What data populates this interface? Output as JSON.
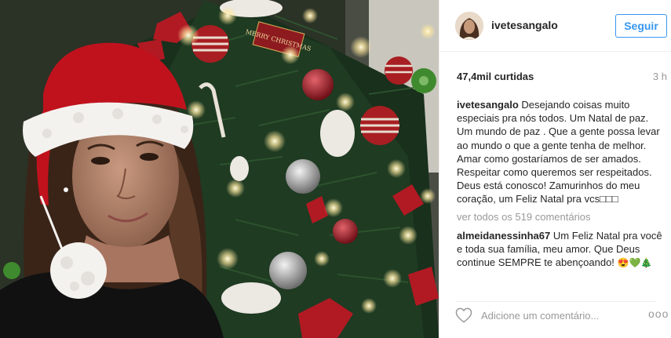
{
  "photo": {
    "alt_icon": "selfie-christmas-tree-photo",
    "ornament_text": "MERRY CHRISTMAS"
  },
  "header": {
    "username": "ivetesangalo",
    "follow_label": "Seguir",
    "accent_color": "#3897f0"
  },
  "stats": {
    "likes": "47,4mil curtidas",
    "time": "3 h"
  },
  "caption": {
    "username": "ivetesangalo",
    "text": "Desejando coisas muito especiais pra nós todos. Um Natal de paz. Um mundo de paz . Que a gente possa levar ao mundo o que a gente tenha de melhor. Amar como gostaríamos de ser amados. Respeitar como queremos ser respeitados. Deus está conosco! Zamurinhos do meu coração, um Feliz Natal pra vcs□□□"
  },
  "view_all": "ver todos os 519 comentários",
  "comment": {
    "username": "almeidanessinha67",
    "text": "Um Feliz Natal pra você e toda sua família, meu amor. Que Deus continue SEMPRE te abençoando!",
    "emojis": "😍💚🎄"
  },
  "footer": {
    "placeholder": "Adicione um comentário...",
    "more": "ooo",
    "icons": [
      "heart-icon",
      "more-options-icon"
    ]
  }
}
